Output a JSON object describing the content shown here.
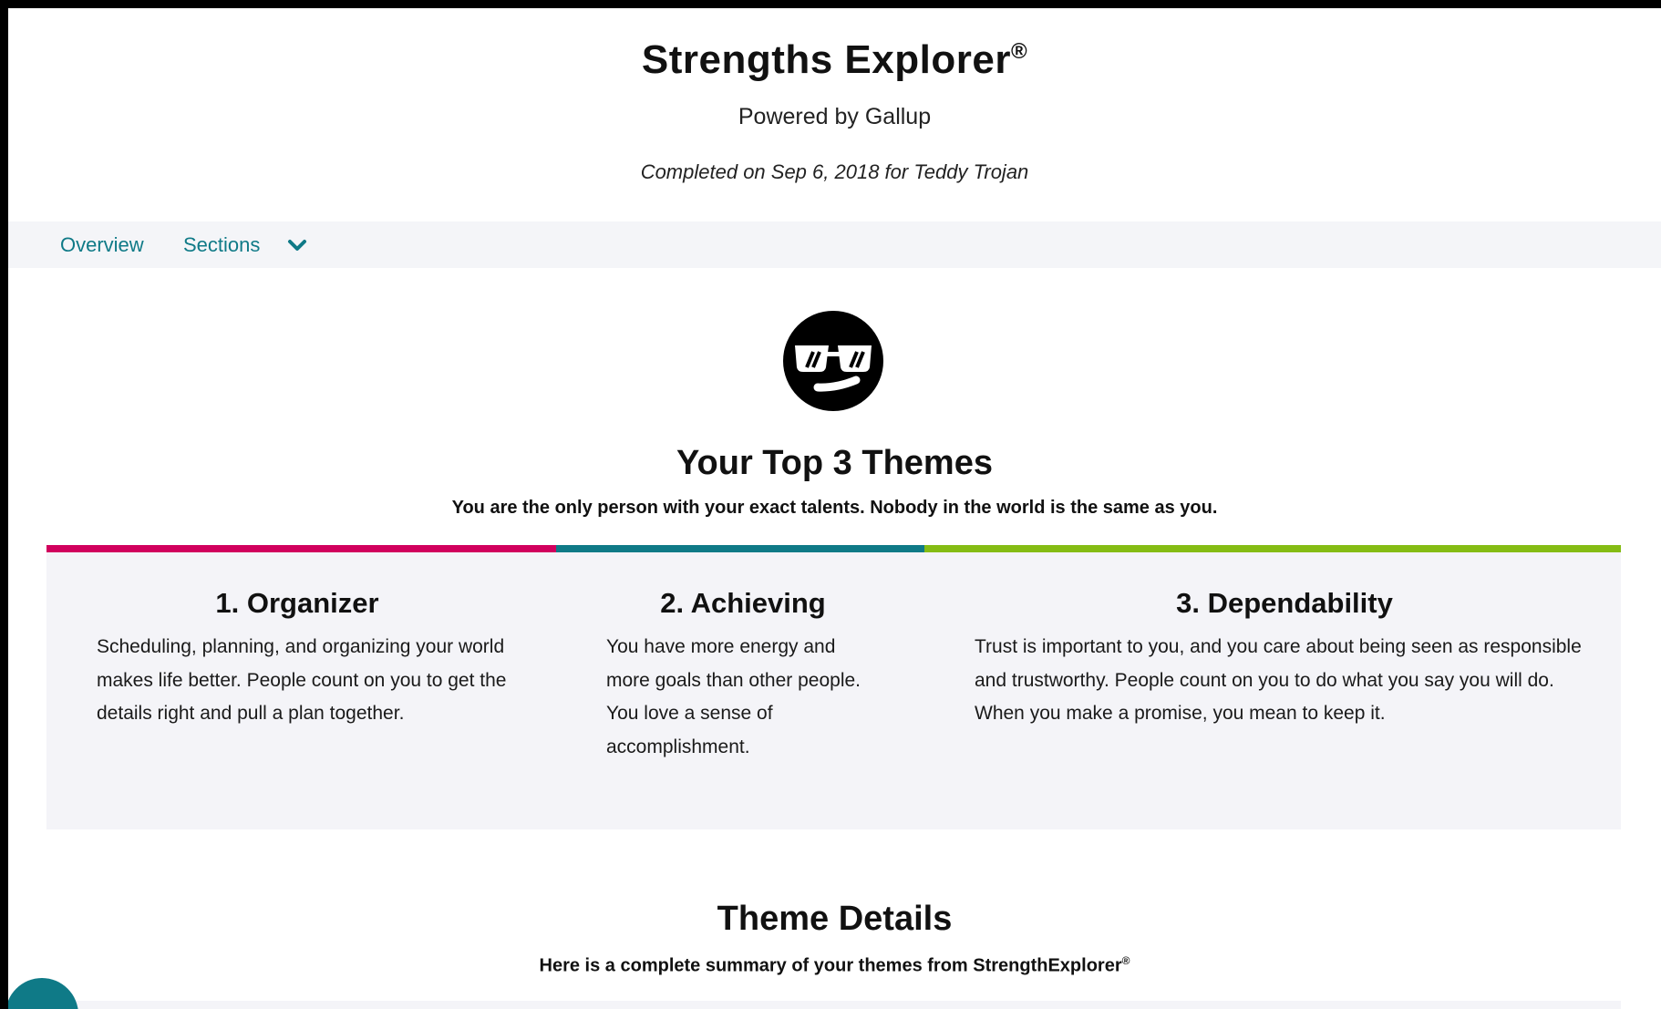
{
  "header": {
    "title": "Strengths Explorer",
    "title_mark": "®",
    "powered_by": "Powered by Gallup",
    "completed": "Completed on Sep 6, 2018 for Teddy Trojan"
  },
  "nav": {
    "overview": "Overview",
    "sections": "Sections",
    "sections_icon": "chevron-down-icon"
  },
  "avatar_icon": "sunglasses-face-icon",
  "top3": {
    "title": "Your Top 3 Themes",
    "subtitle": "You are the only person with your exact talents. Nobody in the world is the same as you.",
    "themes": [
      {
        "heading": "1. Organizer",
        "text": "Scheduling, planning, and organizing your world makes life better. People count on you to get the details right and pull a plan together.",
        "color": "#d1005d"
      },
      {
        "heading": "2. Achieving",
        "text": "You have more energy and more goals than other people. You love a sense of accomplishment.",
        "color": "#0f7a87"
      },
      {
        "heading": "3. Dependability",
        "text": "Trust is important to you, and you care about being seen as responsible and trustworthy. People count on you to do what you say you will do. When you make a promise, you mean to keep it.",
        "color": "#85bc14"
      }
    ]
  },
  "details": {
    "title": "Theme Details",
    "subtitle": "Here is a complete summary of your themes from StrengthExplorer",
    "subtitle_mark": "®"
  },
  "colors": {
    "accent": "#0f7a87",
    "panel": "#f4f4f8"
  }
}
